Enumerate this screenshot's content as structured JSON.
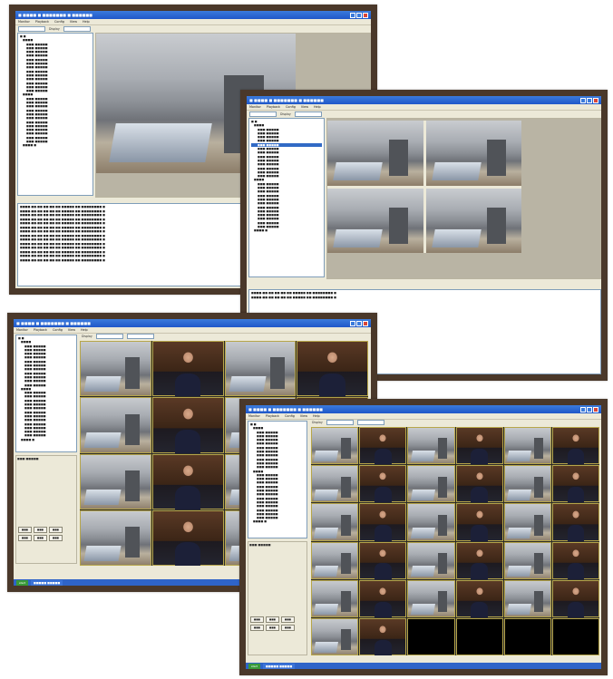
{
  "window": {
    "title": "■ ■■■■ ■ ■■■■■■■ ■ ■■■■■■",
    "menu": [
      "Monitor",
      "Playback",
      "Config",
      "View",
      "Help"
    ],
    "layout_label": "Display",
    "layout_value": "1×1"
  },
  "tree": {
    "group_a": [
      "■ ■",
      "■■■■",
      "■■■ ■■■■■",
      "■■■ ■■■■■",
      "■■■ ■■■■■",
      "■■■ ■■■■■",
      "■■■ ■■■■■",
      "■■■ ■■■■■",
      "■■■ ■■■■■",
      "■■■ ■■■■■",
      "■■■ ■■■■■",
      "■■■ ■■■■■",
      "■■■ ■■■■■",
      "■■■ ■■■■■",
      "■■■ ■■■■■"
    ],
    "group_b": [
      "■■■■",
      "■■■ ■■■■■",
      "■■■ ■■■■■",
      "■■■ ■■■■■",
      "■■■ ■■■■■",
      "■■■ ■■■■■",
      "■■■ ■■■■■",
      "■■■ ■■■■■",
      "■■■ ■■■■■",
      "■■■ ■■■■■",
      "■■■ ■■■■■",
      "■■■ ■■■■■",
      "■■■ ■■■■■",
      "■■■■ ■"
    ]
  },
  "log": [
    "■■■■-■■-■■ ■■:■■:■■   ■■■■■ ■■ ■■■■■■■■ ■",
    "■■■■-■■-■■ ■■:■■:■■   ■■■■■ ■■ ■■■■■■■■ ■",
    "■■■■-■■-■■ ■■:■■:■■   ■■■■■ ■■ ■■■■■■■■ ■",
    "■■■■-■■-■■ ■■:■■:■■   ■■■■■ ■■ ■■■■■■■■ ■",
    "■■■■-■■-■■ ■■:■■:■■   ■■■■■ ■■ ■■■■■■■■ ■",
    "■■■■-■■-■■ ■■:■■:■■   ■■■■■ ■■ ■■■■■■■■ ■",
    "■■■■-■■-■■ ■■:■■:■■   ■■■■■ ■■ ■■■■■■■■ ■",
    "■■■■-■■-■■ ■■:■■:■■   ■■■■■ ■■ ■■■■■■■■ ■",
    "■■■■-■■-■■ ■■:■■:■■   ■■■■■ ■■ ■■■■■■■■ ■",
    "■■■■-■■-■■ ■■:■■:■■   ■■■■■ ■■ ■■■■■■■■ ■",
    "■■■■-■■-■■ ■■:■■:■■   ■■■■■ ■■ ■■■■■■■■ ■",
    "■■■■-■■-■■ ■■:■■:■■   ■■■■■ ■■ ■■■■■■■■ ■",
    "■■■■-■■-■■ ■■:■■:■■   ■■■■■ ■■ ■■■■■■■■ ■",
    "■■■■-■■-■■ ■■:■■:■■   ■■■■■ ■■ ■■■■■■■■ ■"
  ],
  "ptz": {
    "label": "■■■ ■■■■■",
    "buttons": [
      "■■■",
      "■■■",
      "■■■",
      "■■■",
      "■■■",
      "■■■",
      "■■■",
      "■■■",
      "■■■"
    ]
  },
  "taskbar": {
    "start": "start",
    "task": "■■■■■ ■■■■■"
  },
  "colors": {
    "frame": "#4a382a",
    "titlebar": "#1f57c9",
    "grid_border": "#b7a64a"
  }
}
